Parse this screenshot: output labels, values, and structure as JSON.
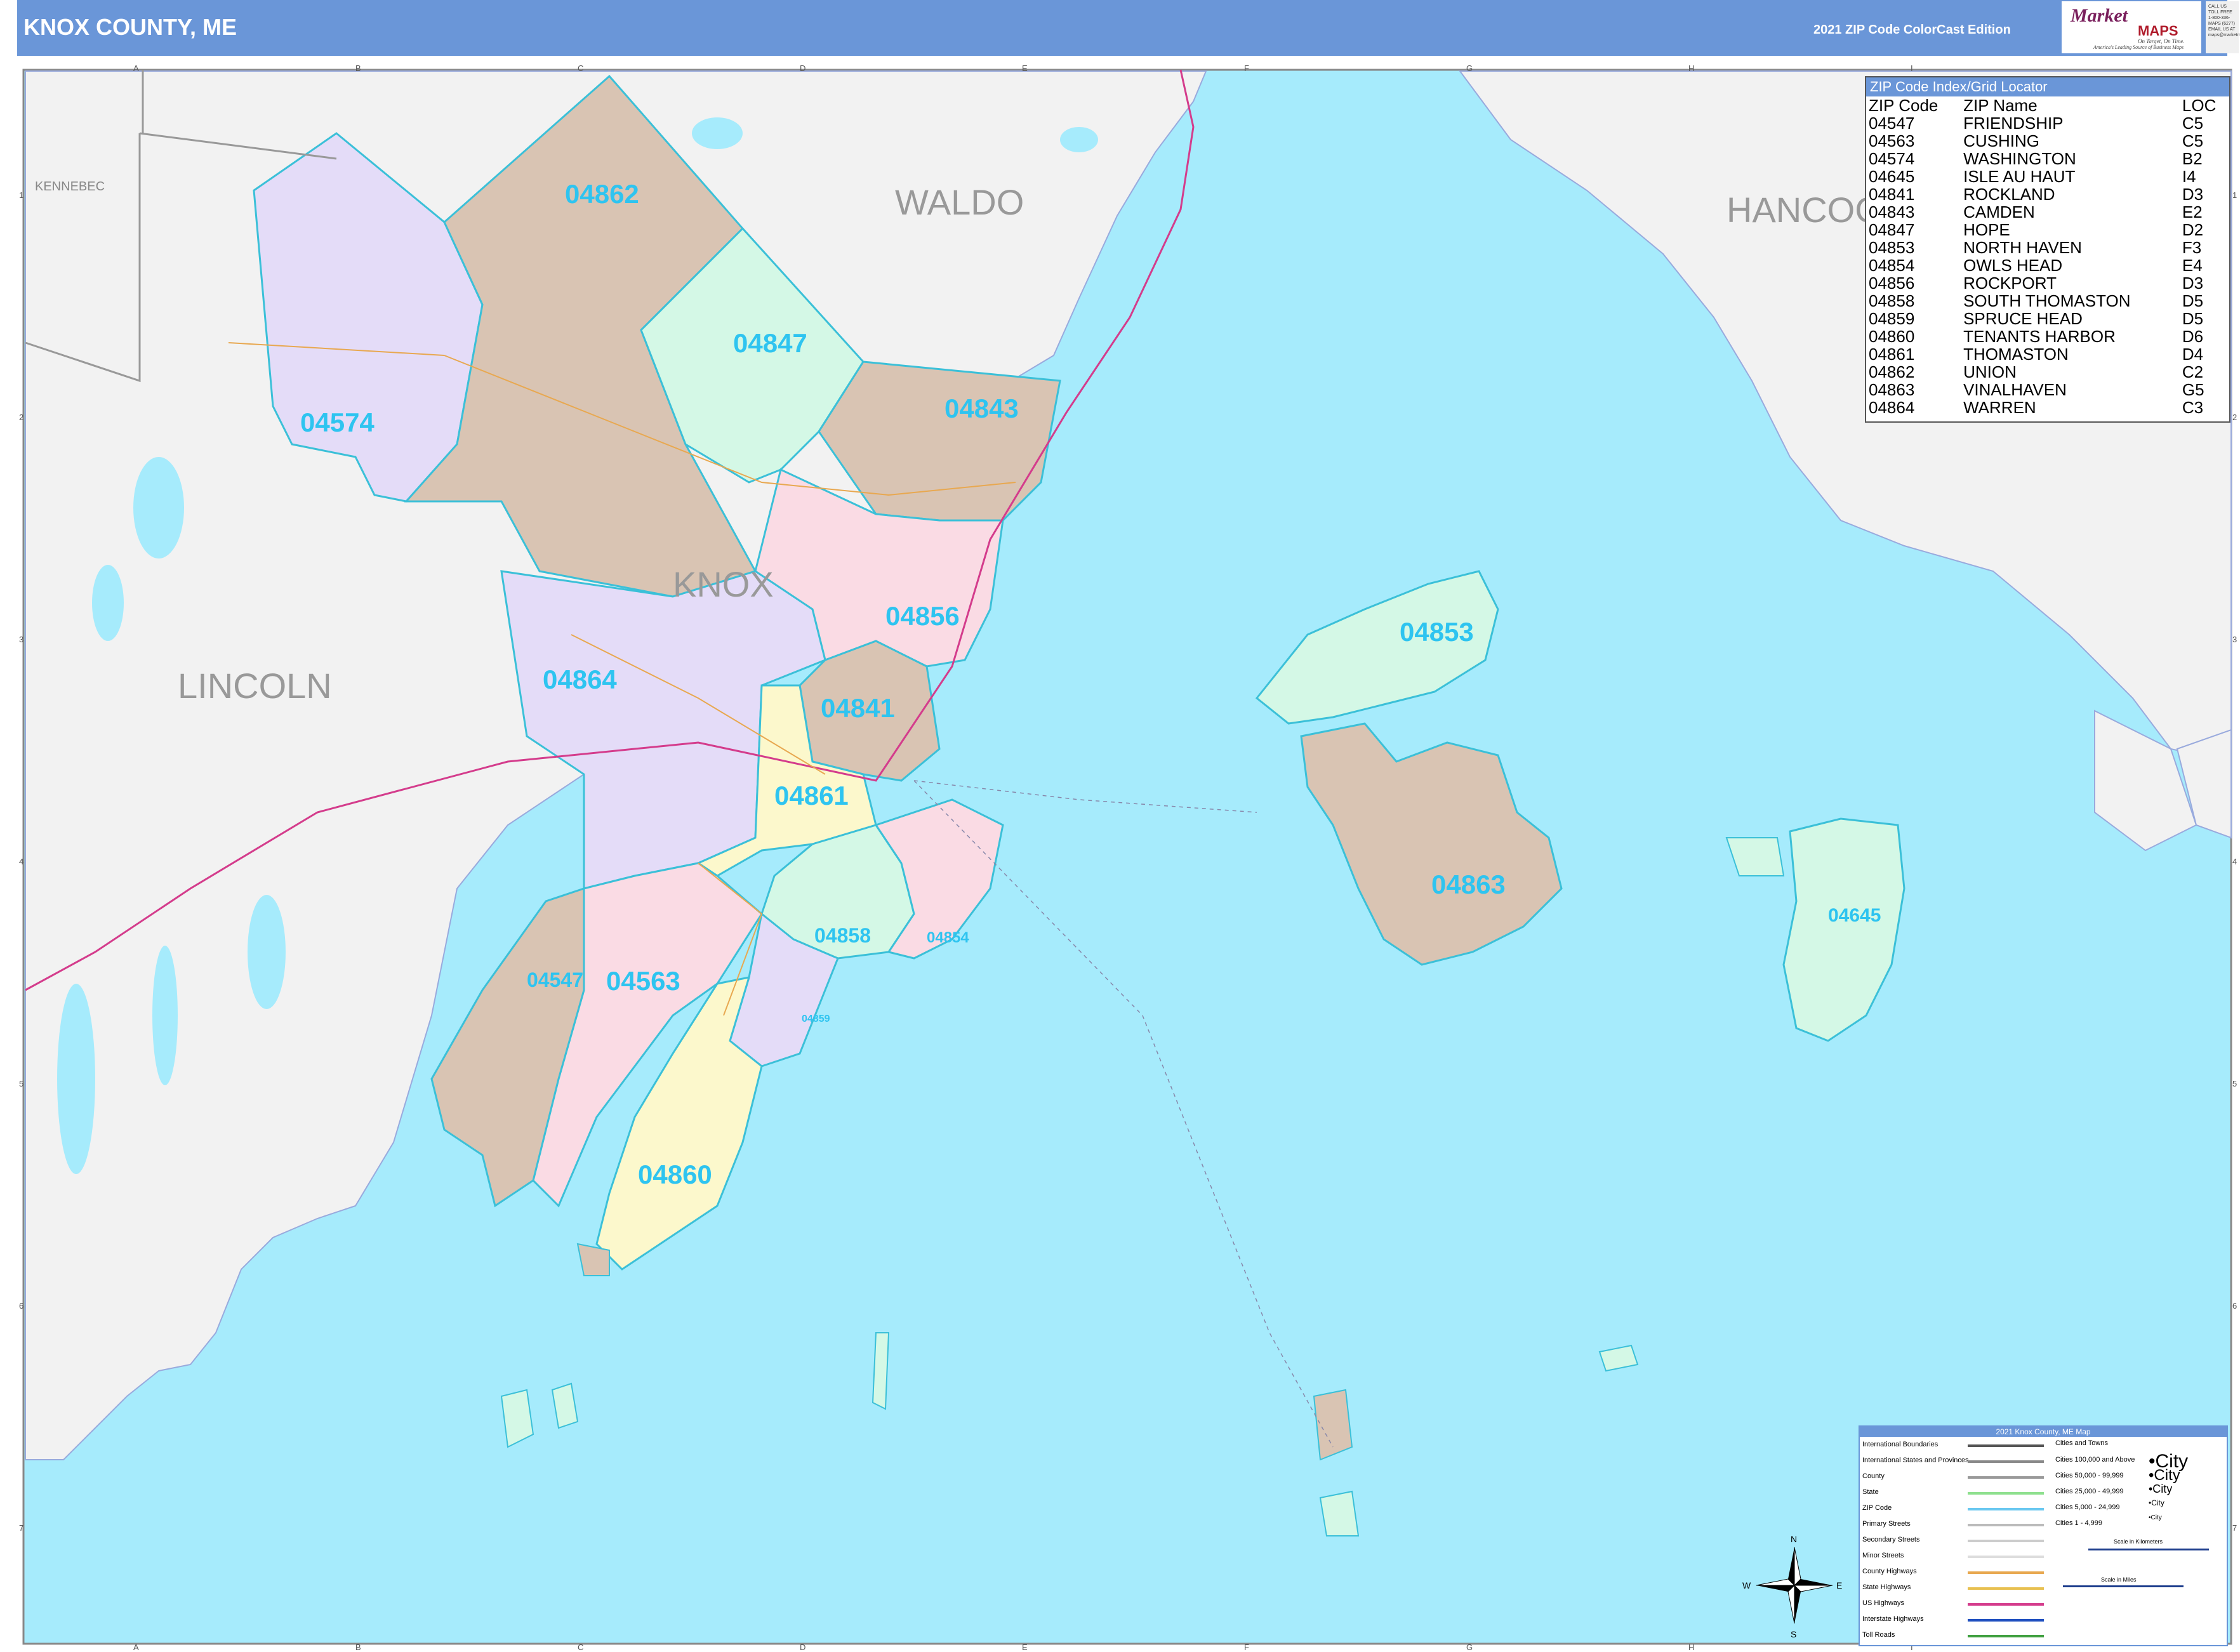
{
  "header": {
    "title": "KNOX COUNTY, ME",
    "edition": "2021 ZIP Code ColorCast Edition",
    "logo_line1": "Market",
    "logo_line2": "MAPS",
    "logo_tagline": "On Target, On Time.",
    "logo_sub": "America's Leading Source of Business Maps",
    "call_box": "CALL US TOLL FREE 1-800-336-MAPS (6277) EMAIL US AT maps@marketmaps.com"
  },
  "counties": [
    "KENNEBEC",
    "WALDO",
    "HANCOCK",
    "KNOX",
    "LINCOLN"
  ],
  "county_labels": {
    "kennebec": "KENNEBEC",
    "waldo": "WALDO",
    "hancock": "HANCOC",
    "knox": "KNOX",
    "lincoln": "LINCOLN"
  },
  "zip_labels": {
    "z04862": "04862",
    "z04847": "04847",
    "z04574": "04574",
    "z04843": "04843",
    "z04856": "04856",
    "z04864": "04864",
    "z04841": "04841",
    "z04861": "04861",
    "z04858": "04858",
    "z04854": "04854",
    "z04547": "04547",
    "z04563": "04563",
    "z04859": "04859",
    "z04860": "04860",
    "z04853": "04853",
    "z04863": "04863",
    "z04645": "04645"
  },
  "zip_colors": {
    "tan": "#d9c4b3",
    "purple": "#e4dcf8",
    "green": "#d4f8e6",
    "pink": "#fadbe4",
    "yellow": "#fcf8cc",
    "water": "#a6ebfc",
    "land": "#f2f2f2",
    "zip_label": "#2ec4f0",
    "header": "#6a96d8"
  },
  "zip_index": {
    "title": "ZIP Code Index/Grid Locator",
    "columns": [
      "ZIP Code",
      "ZIP Name",
      "LOC"
    ],
    "rows": [
      [
        "04547",
        "FRIENDSHIP",
        "C5"
      ],
      [
        "04563",
        "CUSHING",
        "C5"
      ],
      [
        "04574",
        "WASHINGTON",
        "B2"
      ],
      [
        "04645",
        "ISLE AU HAUT",
        "I4"
      ],
      [
        "04841",
        "ROCKLAND",
        "D3"
      ],
      [
        "04843",
        "CAMDEN",
        "E2"
      ],
      [
        "04847",
        "HOPE",
        "D2"
      ],
      [
        "04853",
        "NORTH HAVEN",
        "F3"
      ],
      [
        "04854",
        "OWLS HEAD",
        "E4"
      ],
      [
        "04856",
        "ROCKPORT",
        "D3"
      ],
      [
        "04858",
        "SOUTH THOMASTON",
        "D5"
      ],
      [
        "04859",
        "SPRUCE HEAD",
        "D5"
      ],
      [
        "04860",
        "TENANTS HARBOR",
        "D6"
      ],
      [
        "04861",
        "THOMASTON",
        "D4"
      ],
      [
        "04862",
        "UNION",
        "C2"
      ],
      [
        "04863",
        "VINALHAVEN",
        "G5"
      ],
      [
        "04864",
        "WARREN",
        "C3"
      ]
    ]
  },
  "legend": {
    "title": "2021 Knox County, ME Map",
    "left_items": [
      "International Boundaries",
      "International States and Provinces",
      "County",
      "State",
      "ZIP Code",
      "Primary Streets",
      "Secondary Streets",
      "Minor Streets",
      "County Highways",
      "State Highways",
      "US Highways",
      "Interstate Highways",
      "Toll Roads"
    ],
    "cities_header": "Cities and Towns",
    "city_items": [
      "Cities 100,000 and Above",
      "Cities 50,000 - 99,999",
      "Cities 25,000 - 49,999",
      "Cities 5,000 - 24,999",
      "Cities 1 - 4,999"
    ],
    "city_samples": [
      "•City",
      "•City",
      "•City",
      "•City",
      "•City"
    ],
    "scale_km": "Scale in Kilometers",
    "scale_mi": "Scale in Miles"
  },
  "compass": {
    "n": "N",
    "s": "S",
    "e": "E",
    "w": "W"
  },
  "grid": {
    "cols": [
      "A",
      "B",
      "C",
      "D",
      "E",
      "F",
      "G",
      "H",
      "I"
    ],
    "rows": [
      "1",
      "2",
      "3",
      "4",
      "5",
      "6",
      "7"
    ]
  }
}
